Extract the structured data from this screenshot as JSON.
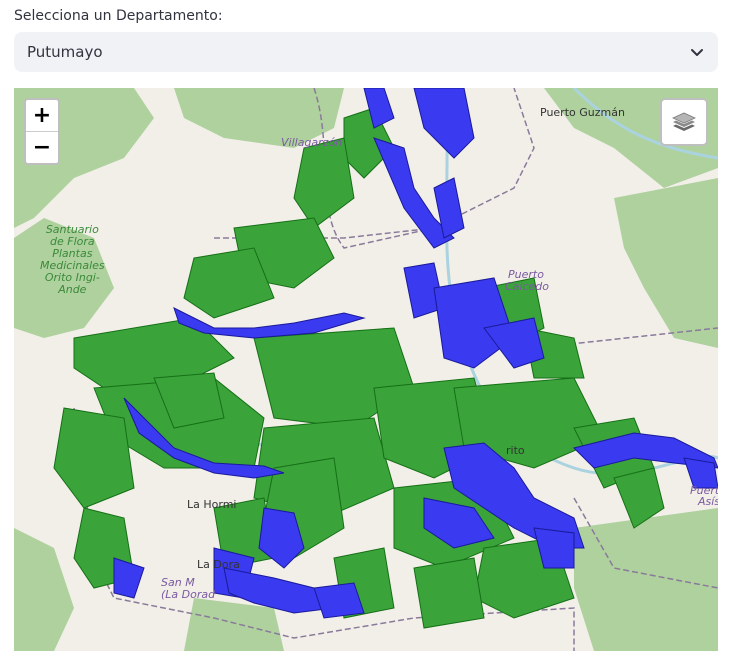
{
  "selector": {
    "label": "Selecciona un Departamento:",
    "value": "Putumayo"
  },
  "map": {
    "zoom_in": "+",
    "zoom_out": "−",
    "places": {
      "puerto_guzman": "Puerto Guzmán",
      "villagarzon": "Villagarzón",
      "puerto_caicedo_1": "Puerto",
      "puerto_caicedo_2": "Caicedo",
      "sanctuary": "Santuario\nde Flora\nPlantas\nMedicinales\nOrito Ingi-\nAnde",
      "la_hormiga": "La Hormi",
      "la_dorada": "La Dora",
      "san_miguel_1": "San M",
      "san_miguel_2": "(La Dorad",
      "orito": "rito",
      "puerto_asis_1": "Puert",
      "puerto_asis_2": "Asís"
    },
    "colors": {
      "basemap": "#f2efe9",
      "forest": "#aed19e",
      "polygon_green": "#2e9e2e",
      "polygon_blue": "#3a3af0",
      "border": "#8a7a9a"
    }
  }
}
